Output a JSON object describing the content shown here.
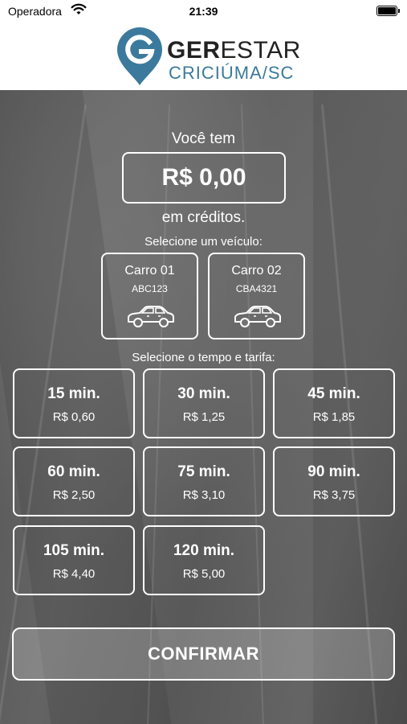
{
  "status_bar": {
    "carrier": "Operadora",
    "time": "21:39"
  },
  "header": {
    "logo": {
      "word_bold": "GER",
      "word_rest": "ESTAR",
      "city": "CRICIÚMA/SC",
      "colors": {
        "mark": "#3b7a9c",
        "text": "#222222"
      }
    }
  },
  "credits": {
    "intro": "Você tem",
    "amount": "R$ 0,00",
    "suffix": "em créditos."
  },
  "vehicles": {
    "label": "Selecione um veículo:",
    "items": [
      {
        "name": "Carro 01",
        "plate": "ABC123",
        "icon": "car-icon"
      },
      {
        "name": "Carro 02",
        "plate": "CBA4321",
        "icon": "car-icon"
      }
    ]
  },
  "tariffs": {
    "label": "Selecione o tempo e tarifa:",
    "items": [
      {
        "minutes": "15 min.",
        "price": "R$ 0,60"
      },
      {
        "minutes": "30 min.",
        "price": "R$ 1,25"
      },
      {
        "minutes": "45 min.",
        "price": "R$ 1,85"
      },
      {
        "minutes": "60 min.",
        "price": "R$ 2,50"
      },
      {
        "minutes": "75 min.",
        "price": "R$ 3,10"
      },
      {
        "minutes": "90 min.",
        "price": "R$ 3,75"
      },
      {
        "minutes": "105 min.",
        "price": "R$ 4,40"
      },
      {
        "minutes": "120 min.",
        "price": "R$ 5,00"
      }
    ]
  },
  "confirm": {
    "label": "CONFIRMAR"
  }
}
